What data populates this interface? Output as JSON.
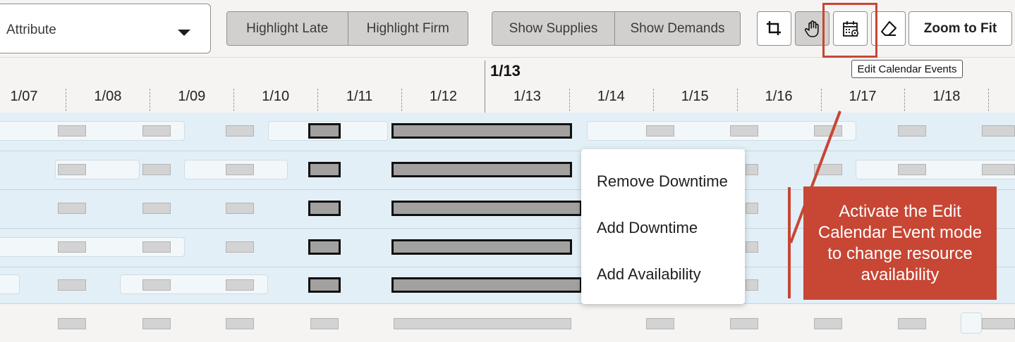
{
  "toolbar": {
    "attribute_select": {
      "value": "Attribute"
    },
    "highlight_group": {
      "late_label": "Highlight Late",
      "firm_label": "Highlight Firm"
    },
    "supply_demand_group": {
      "supplies_label": "Show Supplies",
      "demands_label": "Show Demands"
    },
    "icons": [
      "crop-select-icon",
      "pan-hand-icon",
      "edit-calendar-events-icon",
      "eraser-icon"
    ],
    "zoom_label": "Zoom to Fit",
    "tooltip": "Edit Calendar Events"
  },
  "timeline": {
    "current_date": "1/13",
    "dates": [
      "1/07",
      "1/08",
      "1/09",
      "1/10",
      "1/11",
      "1/12",
      "1/13",
      "1/14",
      "1/15",
      "1/16",
      "1/17",
      "1/18"
    ]
  },
  "context_menu": {
    "items": [
      "Remove Downtime",
      "Add Downtime",
      "Add Availability"
    ]
  },
  "callout": {
    "text": "Activate the Edit Calendar Event mode to change resource availability"
  },
  "colors": {
    "accent": "#c74634",
    "gantt_background": "#e3eff7",
    "toggle_pressed": "#d2d0ce"
  }
}
